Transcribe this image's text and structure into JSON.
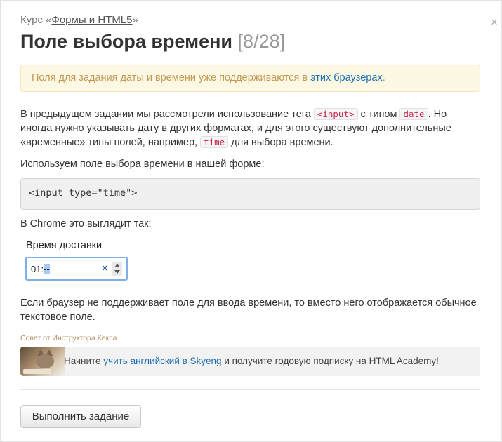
{
  "header": {
    "course_prefix": "Курс «",
    "course_link": "Формы и HTML5",
    "course_suffix": "»",
    "close_glyph": "×",
    "title": "Поле выбора времени",
    "counter": "[8/28]"
  },
  "notice": {
    "text": "Поля для задания даты и времени уже поддерживаются в ",
    "link": "этих браузерах",
    "end": "."
  },
  "intro": {
    "t1": "В предыдущем задании мы рассмотрели использование тега ",
    "c1": "<input>",
    "t2": " с типом ",
    "c2": "date",
    "t3": ". Но иногда нужно указывать дату в других форматах, и для этого существуют дополнительные «временные» типы полей, например, ",
    "c3": "time",
    "t4": " для выбора времени."
  },
  "use_text": "Используем поле выбора времени в нашей форме:",
  "code_block": "<input type=\"time\">",
  "chrome_text": "В Chrome это выглядит так:",
  "demo": {
    "label": "Время доставки",
    "hour": "01",
    "sep": ":",
    "minutes": "--",
    "clear_glyph": "×"
  },
  "fallback_text": "Если браузер не поддерживает поле для ввода времени, то вместо него отображается обычное текстовое поле.",
  "tip": {
    "label": "Совет от Инструктора Кекса",
    "t1": "Начните ",
    "link": "учить английский в Skyeng",
    "t2": " и получите годовую подписку на HTML Academy!"
  },
  "submit_label": "Выполнить задание",
  "colors": {
    "notice_bg": "#fcf8e3",
    "notice_text": "#c09853",
    "link": "#1a6fb0",
    "code_accent": "#c7254e"
  }
}
